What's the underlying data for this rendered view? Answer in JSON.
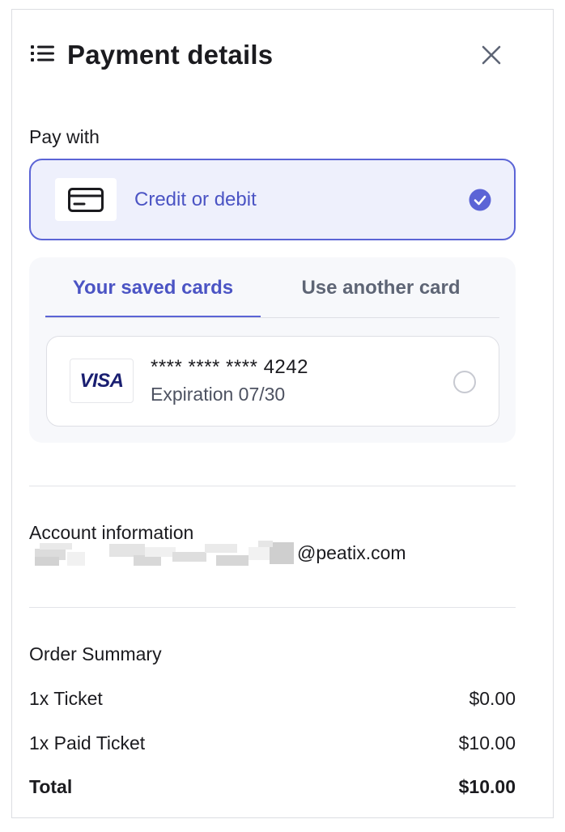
{
  "header": {
    "title": "Payment details",
    "menu_icon": "list-icon",
    "close_icon": "close-icon"
  },
  "payment": {
    "pay_with_label": "Pay with",
    "method": {
      "label": "Credit or debit",
      "icon": "credit-card-icon",
      "selected": true,
      "check_icon": "check-circle-icon"
    },
    "tabs": [
      {
        "label": "Your saved cards",
        "active": true
      },
      {
        "label": "Use another card",
        "active": false
      }
    ],
    "saved_card": {
      "brand": "VISA",
      "number": "**** **** **** 4242",
      "expiration": "Expiration 07/30",
      "selected": false
    }
  },
  "account": {
    "title": "Account information",
    "email_domain": "@peatix.com"
  },
  "order": {
    "title": "Order Summary",
    "items": [
      {
        "label": "1x Ticket",
        "amount": "$0.00"
      },
      {
        "label": "1x Paid Ticket",
        "amount": "$10.00"
      }
    ],
    "total_label": "Total",
    "total_amount": "$10.00"
  },
  "colors": {
    "accent": "#5b64d6",
    "accent_text": "#4b54c4",
    "method_bg": "#eef0fc",
    "section_bg": "#f7f8fb",
    "visa_blue": "#1a1f71"
  }
}
